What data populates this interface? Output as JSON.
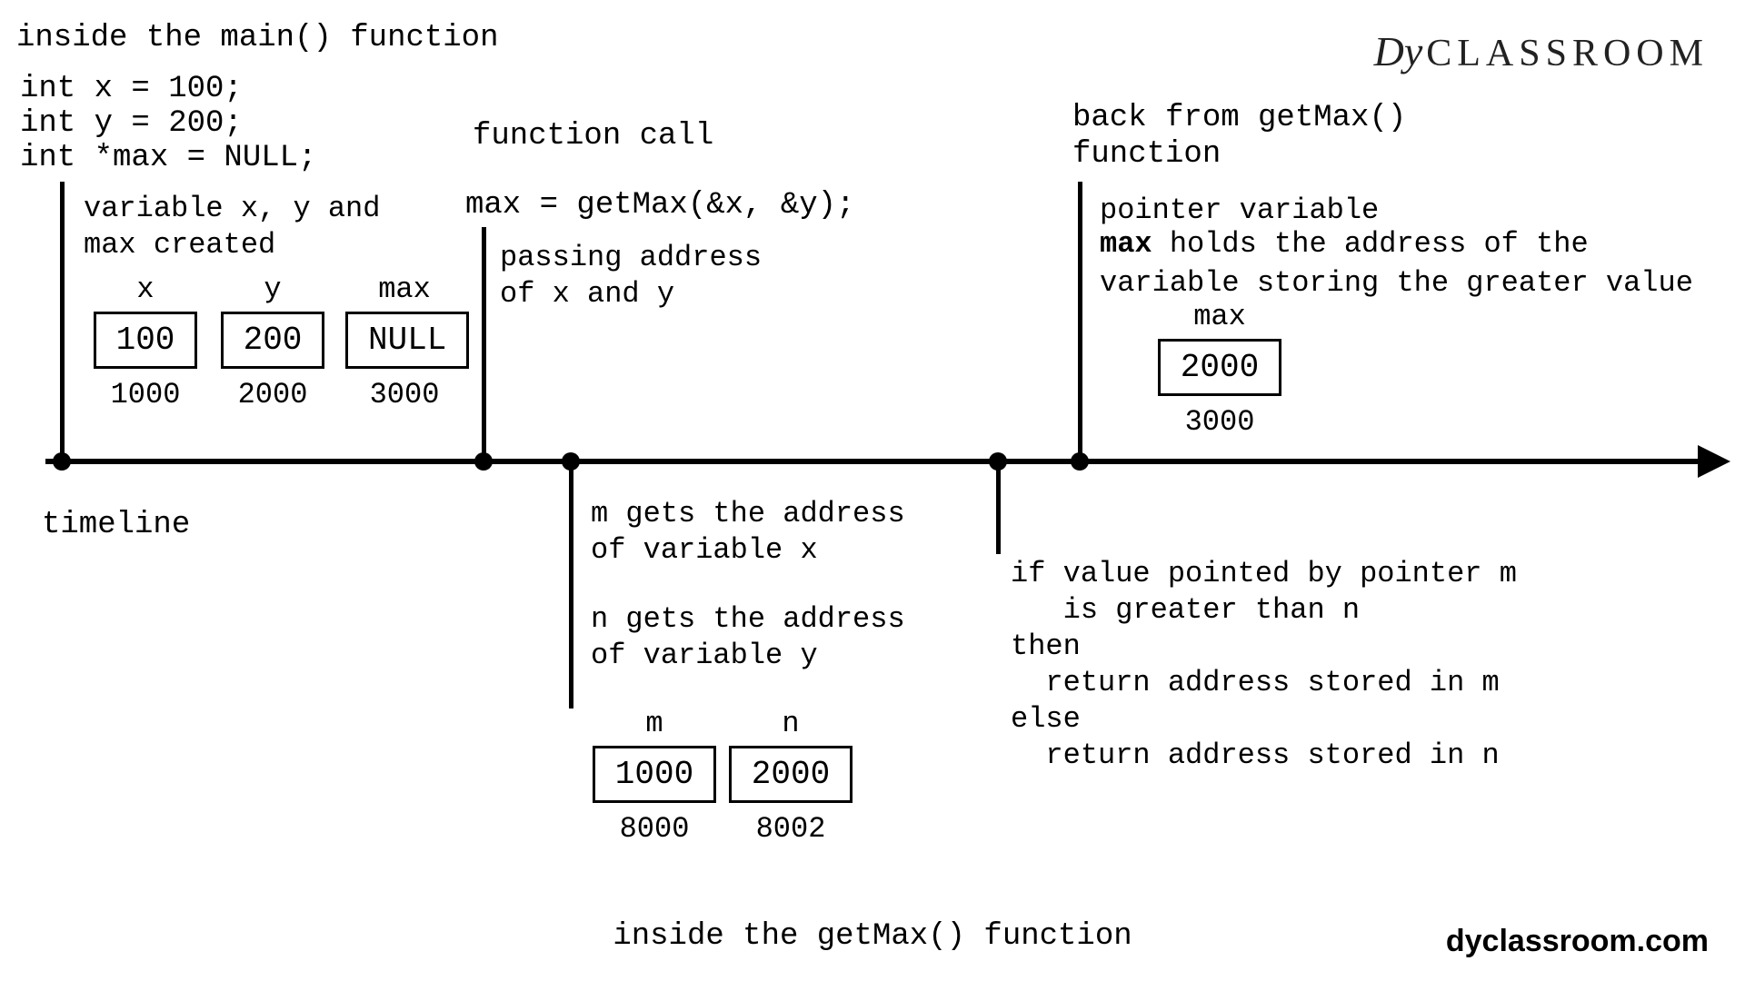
{
  "header_main": "inside the main() function",
  "logo_text": "CLASSROOM",
  "logo_script": "Dy",
  "code": {
    "l1": "int x = 100;",
    "l2": "int y = 200;",
    "l3": "int *max = NULL;"
  },
  "event1": {
    "caption_l1": "variable x, y and",
    "caption_l2": "max created",
    "vars": {
      "x": {
        "name": "x",
        "value": "100",
        "addr": "1000"
      },
      "y": {
        "name": "y",
        "value": "200",
        "addr": "2000"
      },
      "max": {
        "name": "max",
        "value": "NULL",
        "addr": "3000"
      }
    }
  },
  "event2": {
    "title": "function call",
    "call": "max = getMax(&x, &y);",
    "note_l1": "passing address",
    "note_l2": "of x and y"
  },
  "event3": {
    "l1": "m gets the address",
    "l2": "of variable x",
    "l3": "n gets the address",
    "l4": "of variable y",
    "vars": {
      "m": {
        "name": "m",
        "value": "1000",
        "addr": "8000"
      },
      "n": {
        "name": "n",
        "value": "2000",
        "addr": "8002"
      }
    }
  },
  "event4": {
    "l1": "if value pointed by pointer m",
    "l2": "   is greater than n",
    "l3": "then",
    "l4": "  return address stored in m",
    "l5": "else",
    "l6": "  return address stored in n"
  },
  "event5": {
    "title_l1": "back from getMax()",
    "title_l2": "function",
    "note_l1": "pointer variable",
    "note_l2a": "max",
    "note_l2b": " holds the address of the",
    "note_l3": "variable storing the greater value",
    "var": {
      "name": "max",
      "value": "2000",
      "addr": "3000"
    }
  },
  "timeline_label": "timeline",
  "footer_title": "inside the getMax() function",
  "site": "dyclassroom.com"
}
